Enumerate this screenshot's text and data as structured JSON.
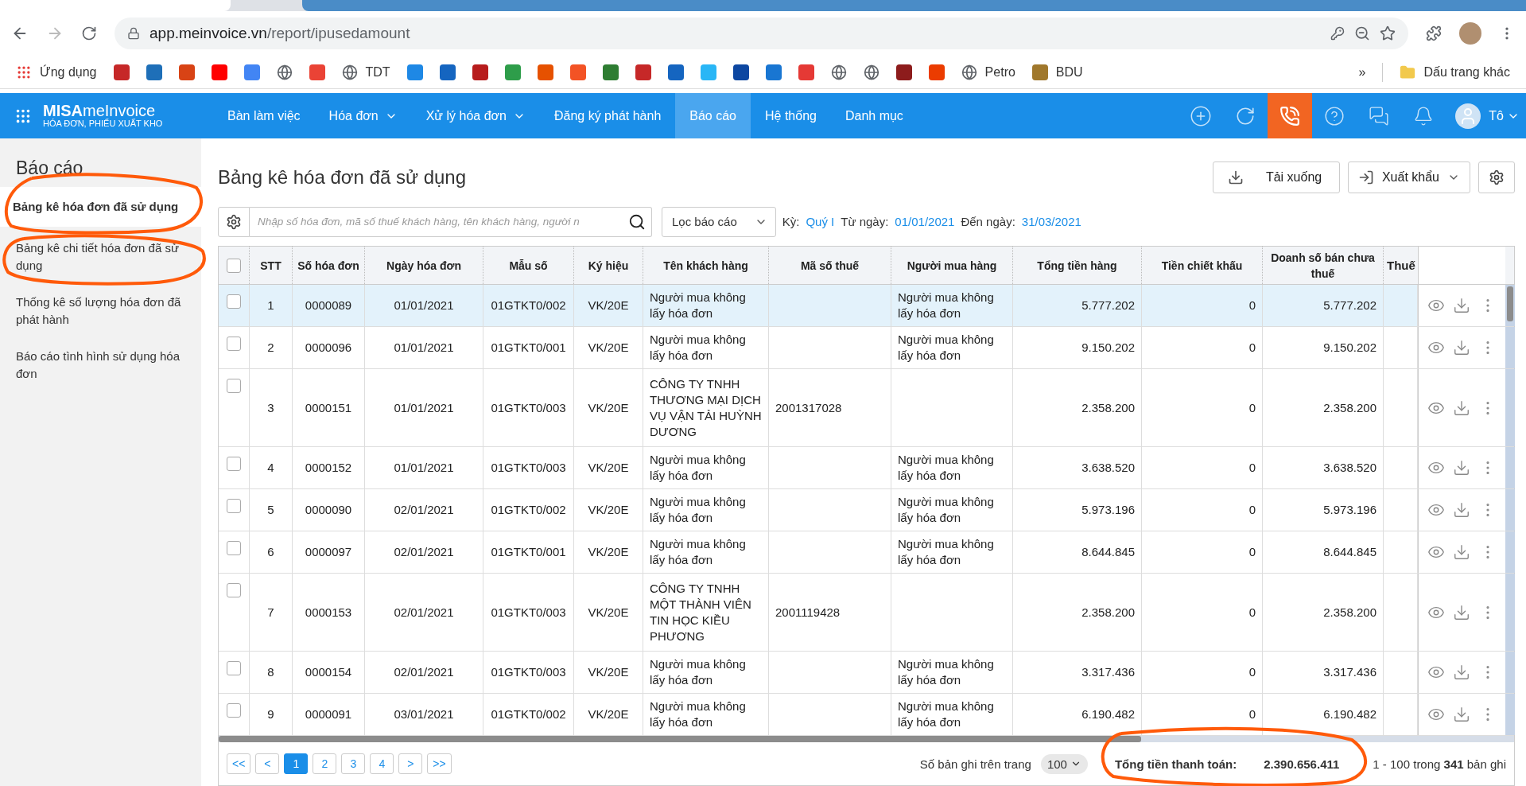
{
  "browser": {
    "url_host": "app.meinvoice.vn",
    "url_path": "/report/ipusedamount",
    "bookmarks": [
      {
        "kind": "apps",
        "label": "Ứng dụng"
      },
      {
        "kind": "icon",
        "color": "#c62828"
      },
      {
        "kind": "icon",
        "color": "#1e6fb8"
      },
      {
        "kind": "icon",
        "color": "#d84315"
      },
      {
        "kind": "icon",
        "color": "#ff0000"
      },
      {
        "kind": "icon",
        "color": "#4285f4"
      },
      {
        "kind": "globe"
      },
      {
        "kind": "icon",
        "color": "#ea4335"
      },
      {
        "kind": "globe",
        "label": "TDT"
      },
      {
        "kind": "icon",
        "color": "#1e88e5"
      },
      {
        "kind": "icon",
        "color": "#1565c0"
      },
      {
        "kind": "icon",
        "color": "#b71c1c"
      },
      {
        "kind": "icon",
        "color": "#2e9d4a"
      },
      {
        "kind": "icon",
        "color": "#e65100"
      },
      {
        "kind": "icon",
        "color": "#f35325"
      },
      {
        "kind": "icon",
        "color": "#2e7d32"
      },
      {
        "kind": "icon",
        "color": "#c62828"
      },
      {
        "kind": "icon",
        "color": "#1565c0"
      },
      {
        "kind": "icon",
        "color": "#29b6f6"
      },
      {
        "kind": "icon",
        "color": "#0d47a1"
      },
      {
        "kind": "icon",
        "color": "#1976d2"
      },
      {
        "kind": "icon",
        "color": "#e53935"
      },
      {
        "kind": "globe"
      },
      {
        "kind": "globe"
      },
      {
        "kind": "icon",
        "color": "#8d1c1c"
      },
      {
        "kind": "icon",
        "color": "#eb3c00"
      },
      {
        "kind": "globe",
        "label": "Petro"
      },
      {
        "kind": "icon",
        "color": "#a0782c",
        "label": "BDU"
      }
    ],
    "overflow": "»",
    "other_bookmarks": "Dấu trang khác"
  },
  "app": {
    "logo_brand": "MISA",
    "logo_product": "meInvoice",
    "logo_tagline": "HÓA ĐƠN, PHIẾU XUẤT KHO",
    "user_name": "Tô"
  },
  "nav": [
    {
      "label": "Bàn làm việc",
      "selected": false,
      "has_menu": false
    },
    {
      "label": "Hóa đơn",
      "selected": false,
      "has_menu": true
    },
    {
      "label": "Xử lý hóa đơn",
      "selected": false,
      "has_menu": true
    },
    {
      "label": "Đăng ký phát hành",
      "selected": false,
      "has_menu": false
    },
    {
      "label": "Báo cáo",
      "selected": true,
      "has_menu": false
    },
    {
      "label": "Hệ thống",
      "selected": false,
      "has_menu": false
    },
    {
      "label": "Danh mục",
      "selected": false,
      "has_menu": false
    }
  ],
  "sidebar": {
    "title": "Báo cáo",
    "items": [
      {
        "label": "Bảng kê hóa đơn đã sử dụng",
        "selected": true
      },
      {
        "label": "Bảng kê chi tiết hóa đơn đã sử dụng",
        "selected": false
      },
      {
        "label": "Thống kê số lượng hóa đơn đã phát hành",
        "selected": false
      },
      {
        "label": "Báo cáo tình hình sử dụng hóa đơn",
        "selected": false
      }
    ]
  },
  "page": {
    "title": "Bảng kê hóa đơn đã sử dụng",
    "download_button": "Tải xuống",
    "export_button": "Xuất khẩu"
  },
  "filter": {
    "search_placeholder": "Nhập số hóa đơn, mã số thuế khách hàng, tên khách hàng, người n",
    "report_filter": "Lọc báo cáo",
    "period_label": "Kỳ:",
    "period": "Quý I",
    "from_label": "Từ ngày:",
    "from": "01/01/2021",
    "to_label": "Đến ngày:",
    "to": "31/03/2021"
  },
  "table": {
    "header_checked": false,
    "columns": [
      "STT",
      "Số hóa đơn",
      "Ngày hóa đơn",
      "Mẫu số",
      "Ký hiệu",
      "Tên khách hàng",
      "Mã số thuế",
      "Người mua hàng",
      "Tổng tiền hàng",
      "Tiền chiết khấu",
      "Doanh số bán chưa thuế",
      "Thuế"
    ],
    "rows": [
      {
        "stt": "1",
        "number": "0000089",
        "date": "01/01/2021",
        "template": "01GTKT0/002",
        "symbol": "VK/20E",
        "customer": "Người mua không lấy hóa đơn",
        "buyer": "Người mua không lấy hóa đơn",
        "total": "5.777.202",
        "discount": "0",
        "revenue": "5.777.202",
        "selected": true,
        "checked": false
      },
      {
        "stt": "2",
        "number": "0000096",
        "date": "01/01/2021",
        "template": "01GTKT0/001",
        "symbol": "VK/20E",
        "customer": "Người mua không lấy hóa đơn",
        "buyer": "Người mua không lấy hóa đơn",
        "total": "9.150.202",
        "discount": "0",
        "revenue": "9.150.202",
        "selected": false,
        "checked": false
      },
      {
        "stt": "3",
        "number": "0000151",
        "date": "01/01/2021",
        "template": "01GTKT0/003",
        "symbol": "VK/20E",
        "customer": "CÔNG TY TNHH THƯƠNG MẠI DỊCH VỤ VẬN TẢI HUỲNH DƯƠNG",
        "tax_code": "2001317028",
        "total": "2.358.200",
        "discount": "0",
        "revenue": "2.358.200",
        "selected": false,
        "checked": false
      },
      {
        "stt": "4",
        "number": "0000152",
        "date": "01/01/2021",
        "template": "01GTKT0/003",
        "symbol": "VK/20E",
        "customer": "Người mua không lấy hóa đơn",
        "buyer": "Người mua không lấy hóa đơn",
        "total": "3.638.520",
        "discount": "0",
        "revenue": "3.638.520",
        "selected": false,
        "checked": false
      },
      {
        "stt": "5",
        "number": "0000090",
        "date": "02/01/2021",
        "template": "01GTKT0/002",
        "symbol": "VK/20E",
        "customer": "Người mua không lấy hóa đơn",
        "buyer": "Người mua không lấy hóa đơn",
        "total": "5.973.196",
        "discount": "0",
        "revenue": "5.973.196",
        "selected": false,
        "checked": false
      },
      {
        "stt": "6",
        "number": "0000097",
        "date": "02/01/2021",
        "template": "01GTKT0/001",
        "symbol": "VK/20E",
        "customer": "Người mua không lấy hóa đơn",
        "buyer": "Người mua không lấy hóa đơn",
        "total": "8.644.845",
        "discount": "0",
        "revenue": "8.644.845",
        "selected": false,
        "checked": false
      },
      {
        "stt": "7",
        "number": "0000153",
        "date": "02/01/2021",
        "template": "01GTKT0/003",
        "symbol": "VK/20E",
        "customer": "CÔNG TY TNHH MỘT THÀNH VIÊN TIN HỌC KIỀU PHƯƠNG",
        "tax_code": "2001119428",
        "total": "2.358.200",
        "discount": "0",
        "revenue": "2.358.200",
        "selected": false,
        "checked": false
      },
      {
        "stt": "8",
        "number": "0000154",
        "date": "02/01/2021",
        "template": "01GTKT0/003",
        "symbol": "VK/20E",
        "customer": "Người mua không lấy hóa đơn",
        "buyer": "Người mua không lấy hóa đơn",
        "total": "3.317.436",
        "discount": "0",
        "revenue": "3.317.436",
        "selected": false,
        "checked": false
      },
      {
        "stt": "9",
        "number": "0000091",
        "date": "03/01/2021",
        "template": "01GTKT0/002",
        "symbol": "VK/20E",
        "customer": "Người mua không lấy hóa đơn",
        "buyer": "Người mua không lấy hóa đơn",
        "total": "6.190.482",
        "discount": "0",
        "revenue": "6.190.482",
        "selected": false,
        "checked": false
      }
    ]
  },
  "footer": {
    "pages": [
      {
        "label": "<<",
        "selected": false
      },
      {
        "label": "<",
        "selected": false
      },
      {
        "label": "1",
        "selected": true
      },
      {
        "label": "2",
        "selected": false
      },
      {
        "label": "3",
        "selected": false
      },
      {
        "label": "4",
        "selected": false
      },
      {
        "label": ">",
        "selected": false
      },
      {
        "label": ">>",
        "selected": false
      }
    ],
    "page_size_label": "Số bản ghi trên trang",
    "page_size": "100",
    "total_label": "Tổng tiền thanh toán:",
    "total": "2.390.656.411",
    "range": "1 - 100 trong **341** bản ghi"
  }
}
